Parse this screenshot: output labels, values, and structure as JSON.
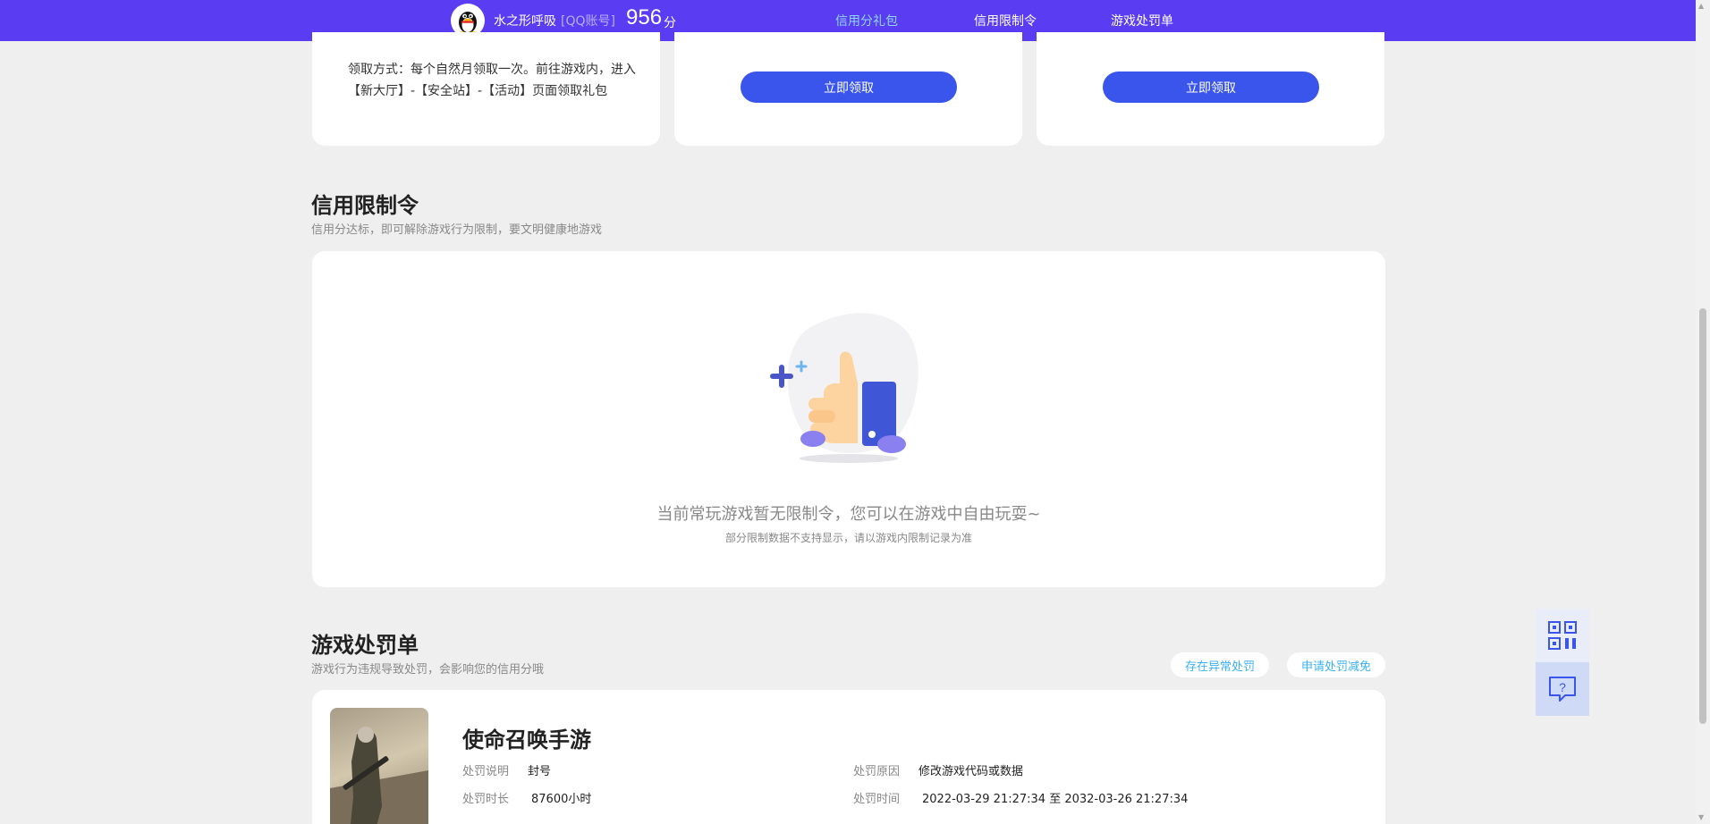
{
  "header": {
    "username": "水之形呼吸",
    "account_type": "[QQ账号]",
    "score": "956",
    "score_unit": "分",
    "tabs": [
      {
        "label": "信用分礼包",
        "active": true
      },
      {
        "label": "信用限制令",
        "active": false
      },
      {
        "label": "游戏处罚单",
        "active": false
      }
    ]
  },
  "gift_cards": {
    "claim_method": "领取方式：每个自然月领取一次。前往游戏内，进入【新大厅】-【安全站】-【活动】页面领取礼包",
    "claim_button_1": "立即领取",
    "claim_button_2": "立即领取"
  },
  "restriction": {
    "title": "信用限制令",
    "subtitle": "信用分达标，即可解除游戏行为限制，要文明健康地游戏",
    "empty_main": "当前常玩游戏暂无限制令，您可以在游戏中自由玩耍~",
    "empty_sub": "部分限制数据不支持显示，请以游戏内限制记录为准"
  },
  "penalty": {
    "title": "游戏处罚单",
    "subtitle": "游戏行为违规导致处罚，会影响您的信用分哦",
    "abnormal_button": "存在异常处罚",
    "appeal_button": "申请处罚减免",
    "game_name": "使命召唤手游",
    "desc_label": "处罚说明",
    "desc_value": "封号",
    "reason_label": "处罚原因",
    "reason_value": "修改游戏代码或数据",
    "duration_label": "处罚时长",
    "duration_value": "87600小时",
    "time_label": "处罚时间",
    "time_value": "2022-03-29 21:27:34 至 2032-03-26 21:27:34"
  },
  "colors": {
    "topbar": "#5a3df2",
    "accent": "#3a55ec",
    "active_tab": "#8fd6ff",
    "link": "#3ab0f4"
  },
  "icons": {
    "qr": "qr-code-icon",
    "help": "help-chat-icon",
    "avatar": "qq-penguin-icon"
  }
}
